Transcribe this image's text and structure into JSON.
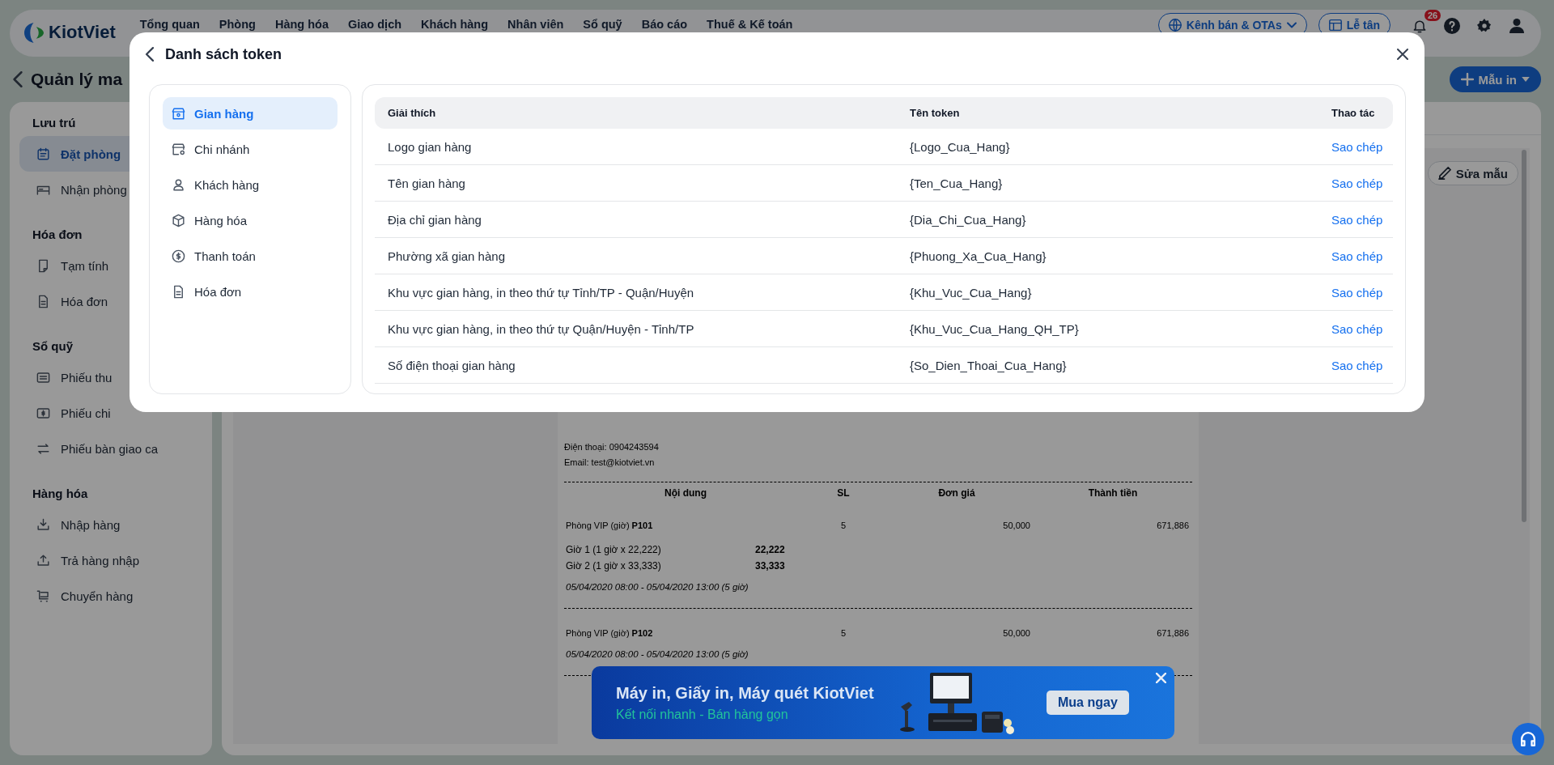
{
  "topbar": {
    "logo": "KiotViet",
    "nav": [
      "Tổng quan",
      "Phòng",
      "Hàng hóa",
      "Giao dịch",
      "Khách hàng",
      "Nhân viên",
      "Sổ quỹ",
      "Báo cáo",
      "Thuế & Kế toán"
    ],
    "sales_channel_button": "Kênh bán & OTAs",
    "reception_button": "Lễ tân",
    "notification_count": "26"
  },
  "page": {
    "title": "Quản lý ma",
    "print_template_button": "Mẫu in"
  },
  "sidebar": {
    "sections": [
      {
        "title": "Lưu trú",
        "items": [
          {
            "label": "Đặt phòng",
            "selected": true
          },
          {
            "label": "Nhận phòng",
            "selected": false
          }
        ]
      },
      {
        "title": "Hóa đơn",
        "items": [
          {
            "label": "Tạm tính",
            "selected": false
          },
          {
            "label": "Hóa đơn",
            "selected": false
          }
        ]
      },
      {
        "title": "Sổ quỹ",
        "items": [
          {
            "label": "Phiếu thu",
            "selected": false
          },
          {
            "label": "Phiếu chi",
            "selected": false
          },
          {
            "label": "Phiếu bàn giao ca",
            "selected": false
          }
        ]
      },
      {
        "title": "Hàng hóa",
        "items": [
          {
            "label": "Nhập hàng",
            "selected": false
          },
          {
            "label": "Trả hàng nhập",
            "selected": false
          },
          {
            "label": "Chuyển hàng",
            "selected": false
          }
        ]
      }
    ]
  },
  "editor": {
    "edit_button": "Sửa mẫu"
  },
  "document": {
    "phone": "Điện thoại: 0904243594",
    "email": "Email: test@kiotviet.vn",
    "columns": [
      "Nội dung",
      "SL",
      "Đơn giá",
      "Thành tiền"
    ],
    "items": [
      {
        "name": "Phòng VIP (giờ) **P101**",
        "qty": "5",
        "price": "50,000",
        "total": "671,886",
        "breakdown": [
          {
            "label": "Giờ 1 (1 giờ x 22,222)",
            "amount": "22,222"
          },
          {
            "label": "Giờ 2 (1 giờ x 33,333)",
            "amount": "33,333"
          }
        ],
        "period": "05/04/2020 08:00 - 05/04/2020 13:00 (5 giờ)"
      },
      {
        "name": "Phòng VIP (giờ) **P102**",
        "qty": "5",
        "price": "50,000",
        "total": "671,886",
        "period": "05/04/2020 08:00 - 05/04/2020 13:00 (5 giờ)"
      }
    ]
  },
  "modal": {
    "title": "Danh sách token",
    "categories": [
      {
        "label": "Gian hàng",
        "selected": true
      },
      {
        "label": "Chi nhánh",
        "selected": false
      },
      {
        "label": "Khách hàng",
        "selected": false
      },
      {
        "label": "Hàng hóa",
        "selected": false
      },
      {
        "label": "Thanh toán",
        "selected": false
      },
      {
        "label": "Hóa đơn",
        "selected": false
      }
    ],
    "table": {
      "columns": [
        "Giải thích",
        "Tên token",
        "Thao tác"
      ],
      "rows": [
        {
          "description": "Logo gian hàng",
          "token": "{Logo_Cua_Hang}",
          "action": "Sao chép"
        },
        {
          "description": "Tên gian hàng",
          "token": "{Ten_Cua_Hang}",
          "action": "Sao chép"
        },
        {
          "description": "Địa chỉ gian hàng",
          "token": "{Dia_Chi_Cua_Hang}",
          "action": "Sao chép"
        },
        {
          "description": "Phường xã gian hàng",
          "token": "{Phuong_Xa_Cua_Hang}",
          "action": "Sao chép"
        },
        {
          "description": "Khu vực gian hàng, in theo thứ tự Tỉnh/TP - Quận/Huyện",
          "token": "{Khu_Vuc_Cua_Hang}",
          "action": "Sao chép"
        },
        {
          "description": "Khu vực gian hàng, in theo thứ tự Quận/Huyện - Tỉnh/TP",
          "token": "{Khu_Vuc_Cua_Hang_QH_TP}",
          "action": "Sao chép"
        },
        {
          "description": "Số điện thoại gian hàng",
          "token": "{So_Dien_Thoai_Cua_Hang}",
          "action": "Sao chép"
        }
      ]
    }
  },
  "banner": {
    "title": "Máy in, Giấy in, Máy quét KiotViet",
    "subtitle": "Kết nối nhanh - Bán hàng gọn",
    "button": "Mua ngay"
  }
}
